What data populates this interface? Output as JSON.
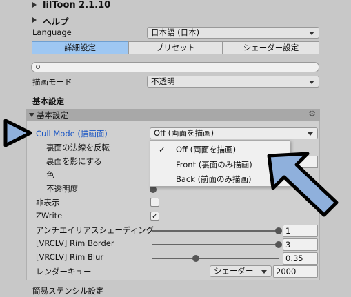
{
  "header": {
    "title": "lilToon 2.1.10",
    "help": "ヘルプ"
  },
  "language": {
    "label": "Language",
    "value": "日本語 (日本)"
  },
  "tabs": [
    {
      "label": "詳細設定",
      "active": true
    },
    {
      "label": "プリセット",
      "active": false
    },
    {
      "label": "シェーダー設定",
      "active": false
    }
  ],
  "search": {
    "value": ""
  },
  "render_mode": {
    "label": "描画モード",
    "value": "不透明"
  },
  "section_title": "基本設定",
  "foldout": {
    "title": "基本設定"
  },
  "properties": {
    "cull_mode": {
      "label": "Cull Mode (描画面)",
      "value": "Off (両面を描画)"
    },
    "flip_normal": "裏面の法線を反転",
    "shadow_back": "裏面を影にする",
    "color": "色",
    "opacity": "不透明度",
    "invisible": {
      "label": "非表示",
      "checked": false
    },
    "zwrite": {
      "label": "ZWrite",
      "checked": true
    },
    "aa_shading": {
      "label": "アンチエイリアスシェーディング",
      "value": "1",
      "level": 1
    },
    "rim_border": {
      "label": "[VRCLV] Rim Border",
      "value": "3",
      "level": 1
    },
    "rim_blur": {
      "label": "[VRCLV] Rim Blur",
      "value": "0.35",
      "level": 0.35
    },
    "render_queue": {
      "label": "レンダーキュー",
      "dropdown": "シェーダーから",
      "value": "2000"
    },
    "stencil": "簡易ステンシル設定"
  },
  "dropdown_menu": {
    "items": [
      {
        "label": "Off (両面を描画)",
        "checked": true
      },
      {
        "label": "Front (裏面のみ描画)",
        "checked": false
      },
      {
        "label": "Back (前面のみ描画)",
        "checked": false
      }
    ]
  },
  "colors": {
    "active_tab": "#9ec7f2",
    "highlight_label": "#1a56c4",
    "annotation_arrow": "#8fb0dc"
  }
}
